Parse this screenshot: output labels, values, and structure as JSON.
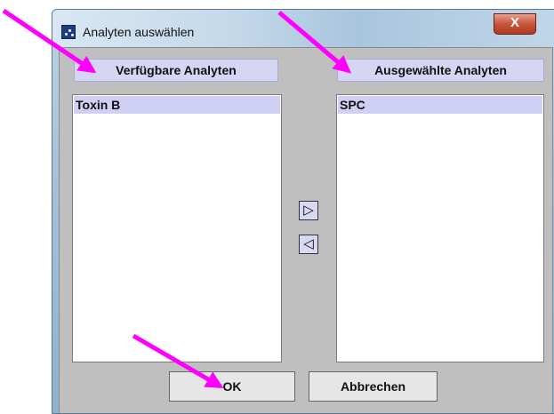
{
  "window": {
    "title": "Analyten auswählen",
    "close_label": "X"
  },
  "available": {
    "header": "Verfügbare Analyten",
    "items": [
      "Toxin B"
    ]
  },
  "selected": {
    "header": "Ausgewählte Analyten",
    "items": [
      "SPC"
    ]
  },
  "controls": {
    "add_label": "▷",
    "remove_label": "◁"
  },
  "buttons": {
    "ok_label": "OK",
    "cancel_label": "Abbrechen"
  },
  "colors": {
    "annotation_arrow": "#ff00ff",
    "list_selection": "#cfd0f3",
    "header_bg": "#d4d6f3"
  }
}
